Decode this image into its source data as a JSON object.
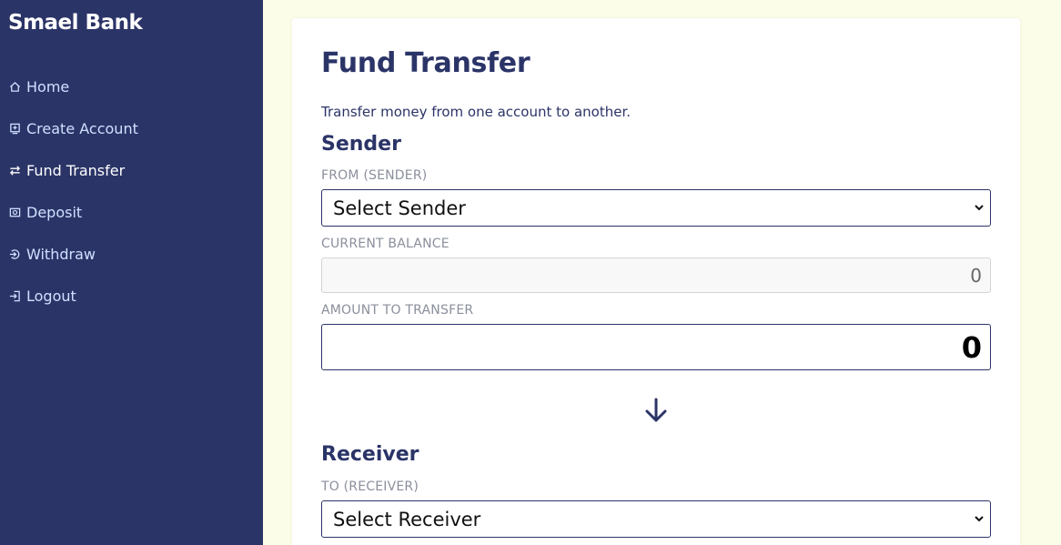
{
  "app": {
    "brand": "Smael Bank"
  },
  "sidebar": {
    "items": [
      {
        "label": "Home",
        "icon": "home-icon",
        "active": false
      },
      {
        "label": "Create Account",
        "icon": "create-account-icon",
        "active": false
      },
      {
        "label": "Fund Transfer",
        "icon": "transfer-icon",
        "active": true
      },
      {
        "label": "Deposit",
        "icon": "deposit-icon",
        "active": false
      },
      {
        "label": "Withdraw",
        "icon": "withdraw-icon",
        "active": false
      },
      {
        "label": "Logout",
        "icon": "logout-icon",
        "active": false
      }
    ]
  },
  "main": {
    "title": "Fund Transfer",
    "subtitle": "Transfer money from one account to another.",
    "sender": {
      "heading": "Sender",
      "from_label": "FROM (SENDER)",
      "from_value": "Select Sender",
      "balance_label": "CURRENT BALANCE",
      "balance_value": "0",
      "amount_label": "AMOUNT TO TRANSFER",
      "amount_value": "0"
    },
    "receiver": {
      "heading": "Receiver",
      "to_label": "TO (RECEIVER)",
      "to_value": "Select Receiver"
    }
  },
  "colors": {
    "sidebar_bg": "#2b3467",
    "accent": "#2b3467",
    "page_bg": "#fbfde9"
  }
}
